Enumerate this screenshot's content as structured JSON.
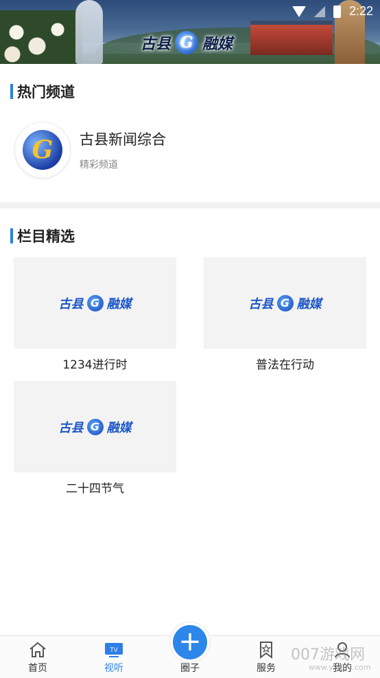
{
  "status_bar": {
    "time": "2:22"
  },
  "header": {
    "logo_text_left": "古县",
    "logo_text_right": "融媒",
    "logo_glyph": "G"
  },
  "hot_channels": {
    "title": "热门频道",
    "items": [
      {
        "name": "古县新闻综合",
        "subtitle": "精彩频道"
      }
    ]
  },
  "featured": {
    "title": "栏目精选",
    "thumb_text_left": "古县",
    "thumb_text_right": "融媒",
    "items": [
      {
        "label": "1234进行时"
      },
      {
        "label": "普法在行动"
      },
      {
        "label": "二十四节气"
      }
    ]
  },
  "bottom_nav": {
    "items": [
      {
        "label": "首页",
        "icon": "home-icon"
      },
      {
        "label": "视听",
        "icon": "tv-icon",
        "icon_text": "TV"
      },
      {
        "label": "圈子",
        "icon": "plus-icon"
      },
      {
        "label": "服务",
        "icon": "bookmark-star-icon"
      },
      {
        "label": "我的",
        "icon": "user-icon"
      }
    ],
    "active_index": 1,
    "accent_color": "#2d7ee6"
  },
  "watermark": {
    "text": "007游戏网",
    "sub": "www.yx007.com"
  }
}
